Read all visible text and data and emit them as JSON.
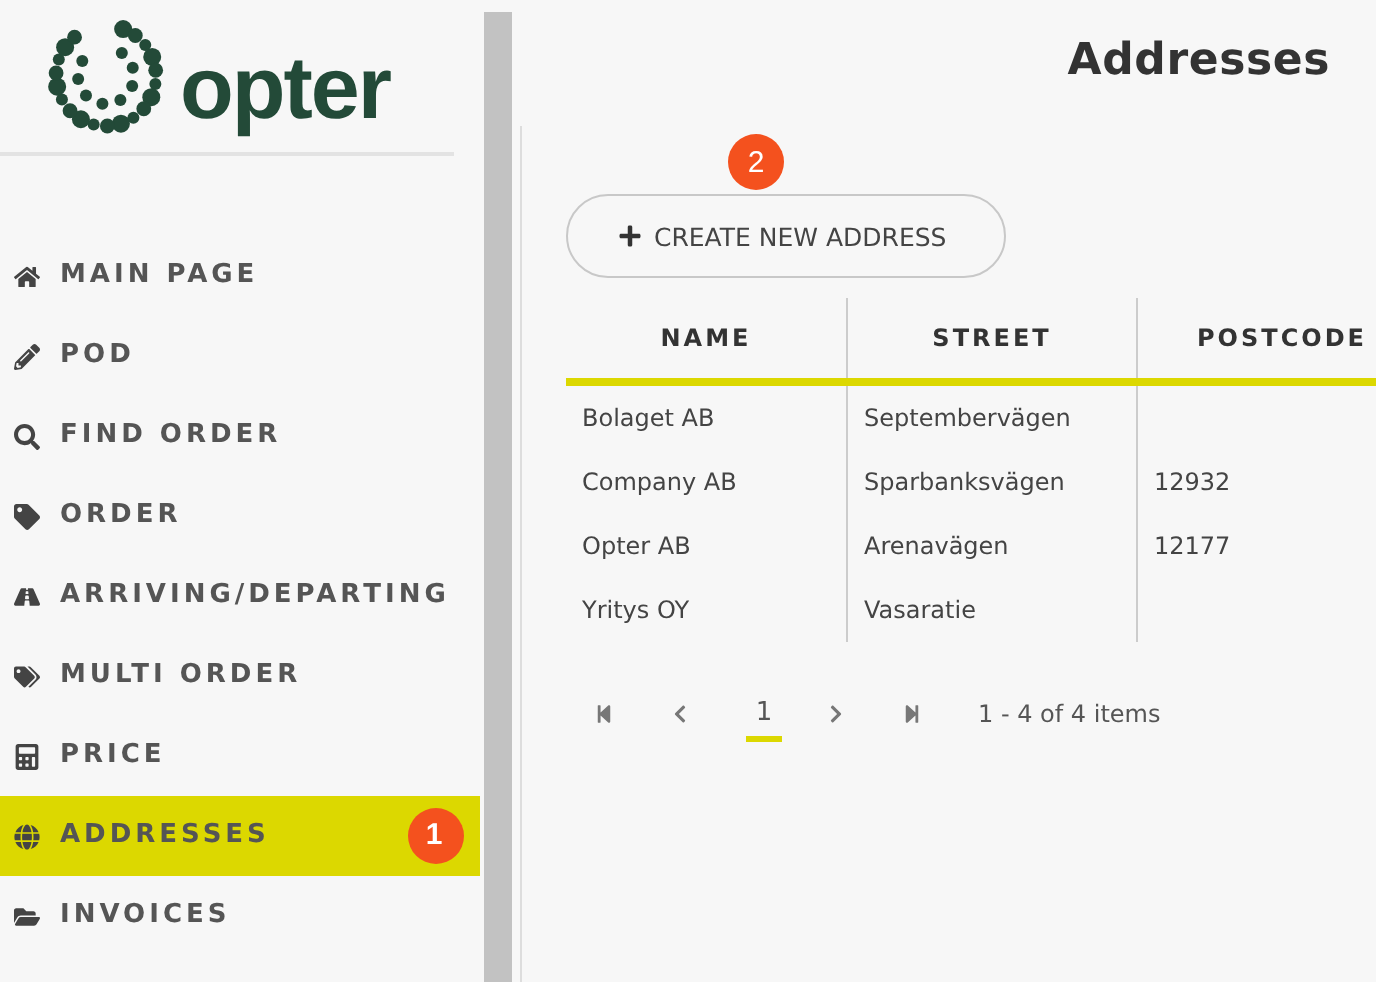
{
  "logo": {
    "text": "opter"
  },
  "nav": [
    {
      "label": "MAIN PAGE",
      "selected": false
    },
    {
      "label": "POD",
      "selected": false
    },
    {
      "label": "FIND ORDER",
      "selected": false
    },
    {
      "label": "ORDER",
      "selected": false
    },
    {
      "label": "ARRIVING/DEPARTING",
      "selected": false
    },
    {
      "label": "MULTI ORDER",
      "selected": false
    },
    {
      "label": "PRICE",
      "selected": false
    },
    {
      "label": "ADDRESSES",
      "selected": true,
      "badge": "1"
    },
    {
      "label": "INVOICES",
      "selected": false
    }
  ],
  "page_title": "Addresses",
  "create_button": {
    "label": "CREATE NEW ADDRESS",
    "badge": "2"
  },
  "table": {
    "columns": [
      "NAME",
      "STREET",
      "POSTCODE"
    ],
    "rows": [
      [
        "Bolaget AB",
        "Septembervägen",
        ""
      ],
      [
        "Company AB",
        "Sparbanksvägen",
        "12932"
      ],
      [
        "Opter AB",
        "Arenavägen",
        "12177"
      ],
      [
        "Yritys OY",
        "Vasaratie",
        ""
      ]
    ]
  },
  "pager": {
    "pages": [
      {
        "label": "1",
        "selected": true
      }
    ],
    "summary": "1 - 4 of 4 items"
  }
}
